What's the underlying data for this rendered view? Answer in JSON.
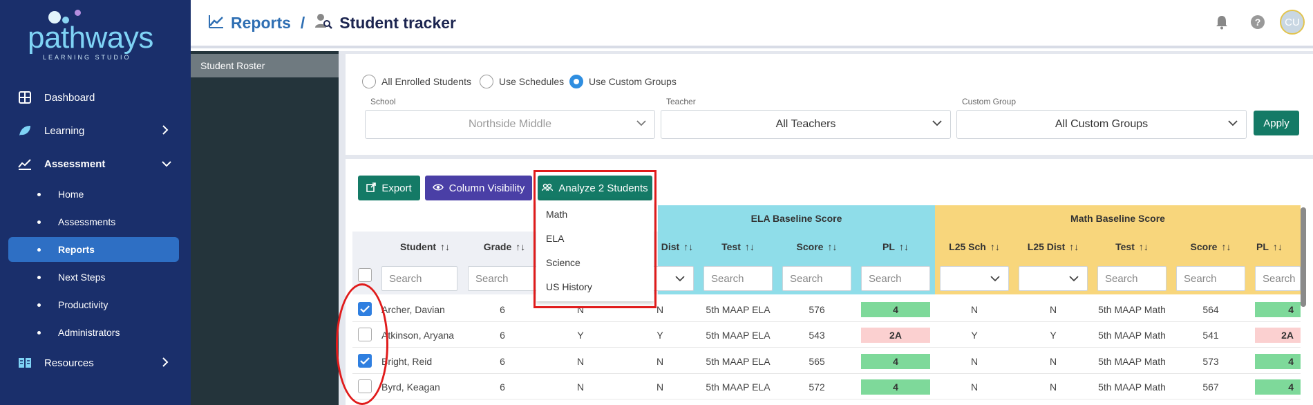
{
  "logo": {
    "name": "pathways",
    "tagline": "LEARNING STUDIO"
  },
  "nav": {
    "dashboard": "Dashboard",
    "learning": "Learning",
    "assessment": "Assessment",
    "assessment_sub": [
      "Home",
      "Assessments",
      "Reports",
      "Next Steps",
      "Productivity",
      "Administrators"
    ],
    "resources": "Resources"
  },
  "header": {
    "crumb1": "Reports",
    "sep": "/",
    "crumb2": "Student tracker",
    "avatar": "CU"
  },
  "sidebar2": {
    "roster": "Student Roster"
  },
  "filters": {
    "radio_all": "All Enrolled Students",
    "radio_schedules": "Use Schedules",
    "radio_custom": "Use Custom Groups",
    "school_label": "School",
    "school_value": "Northside Middle",
    "teacher_label": "Teacher",
    "teacher_value": "All Teachers",
    "group_label": "Custom Group",
    "group_value": "All Custom Groups",
    "apply": "Apply"
  },
  "toolbar": {
    "export": "Export",
    "column_visibility": "Column Visibility",
    "analyze": "Analyze 2 Students"
  },
  "dropdown": [
    "Math",
    "ELA",
    "Science",
    "US History"
  ],
  "groups": {
    "ela": "ELA Baseline Score",
    "math": "Math Baseline Score"
  },
  "columns": {
    "student": "Student",
    "grade": "Grade",
    "dist": "Dist",
    "test": "Test",
    "score": "Score",
    "pl": "PL",
    "l25sch": "L25 Sch",
    "l25dist": "L25 Dist",
    "mtest": "Test",
    "mscore": "Score",
    "mpl": "PL"
  },
  "search_placeholder": "Search",
  "rows": [
    {
      "checked": true,
      "name": "Archer, Davian",
      "grade": "6",
      "c3": "N",
      "dist": "N",
      "test": "5th MAAP ELA",
      "score": "576",
      "pl": "4",
      "l25sch": "N",
      "l25dist": "N",
      "mtest": "5th MAAP Math",
      "mscore": "564",
      "mpl": "4"
    },
    {
      "checked": false,
      "name": "Atkinson, Aryana",
      "grade": "6",
      "c3": "Y",
      "dist": "Y",
      "test": "5th MAAP ELA",
      "score": "543",
      "pl": "2A",
      "l25sch": "Y",
      "l25dist": "Y",
      "mtest": "5th MAAP Math",
      "mscore": "541",
      "mpl": "2A"
    },
    {
      "checked": true,
      "name": "Bright, Reid",
      "grade": "6",
      "c3": "N",
      "dist": "N",
      "test": "5th MAAP ELA",
      "score": "565",
      "pl": "4",
      "l25sch": "N",
      "l25dist": "N",
      "mtest": "5th MAAP Math",
      "mscore": "573",
      "mpl": "4"
    },
    {
      "checked": false,
      "name": "Byrd, Keagan",
      "grade": "6",
      "c3": "N",
      "dist": "N",
      "test": "5th MAAP ELA",
      "score": "572",
      "pl": "4",
      "l25sch": "N",
      "l25dist": "N",
      "mtest": "5th MAAP Math",
      "mscore": "567",
      "mpl": "4"
    }
  ],
  "colors": {
    "pl_high": "#7ed99a",
    "pl_low": "#fbd0d0",
    "ela_header": "#8fdde9",
    "math_header": "#f8d67c",
    "highlight": "#e01b1b"
  }
}
